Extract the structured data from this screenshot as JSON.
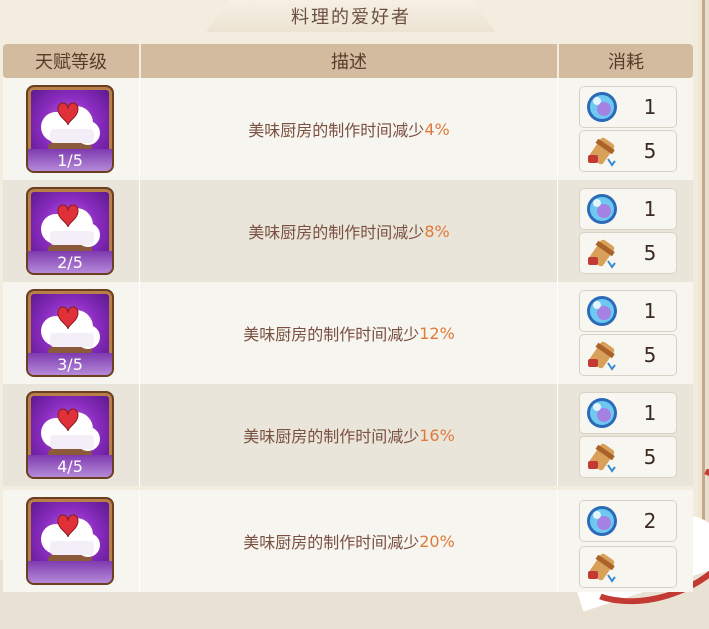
{
  "title": "料理的爱好者",
  "columns": {
    "level": "天赋等级",
    "description": "描述",
    "cost": "消耗"
  },
  "icons": {
    "talent": "chef-hat-heart-icon",
    "orb": "blue-orb-icon",
    "scroll": "scroll-icon"
  },
  "colors": {
    "header_bg": "#d2bb9e",
    "highlight": "#e07a3a",
    "text": "#7a5040"
  },
  "rows": [
    {
      "level": "1/5",
      "desc_text": "美味厨房的制作时间减少",
      "desc_value": "4%",
      "orb_cost": "1",
      "scroll_cost": "5"
    },
    {
      "level": "2/5",
      "desc_text": "美味厨房的制作时间减少",
      "desc_value": "8%",
      "orb_cost": "1",
      "scroll_cost": "5"
    },
    {
      "level": "3/5",
      "desc_text": "美味厨房的制作时间减少",
      "desc_value": "12%",
      "orb_cost": "1",
      "scroll_cost": "5"
    },
    {
      "level": "4/5",
      "desc_text": "美味厨房的制作时间减少",
      "desc_value": "16%",
      "orb_cost": "1",
      "scroll_cost": "5"
    },
    {
      "level": "",
      "desc_text": "美味厨房的制作时间减少",
      "desc_value": "20%",
      "orb_cost": "2",
      "scroll_cost": ""
    }
  ]
}
